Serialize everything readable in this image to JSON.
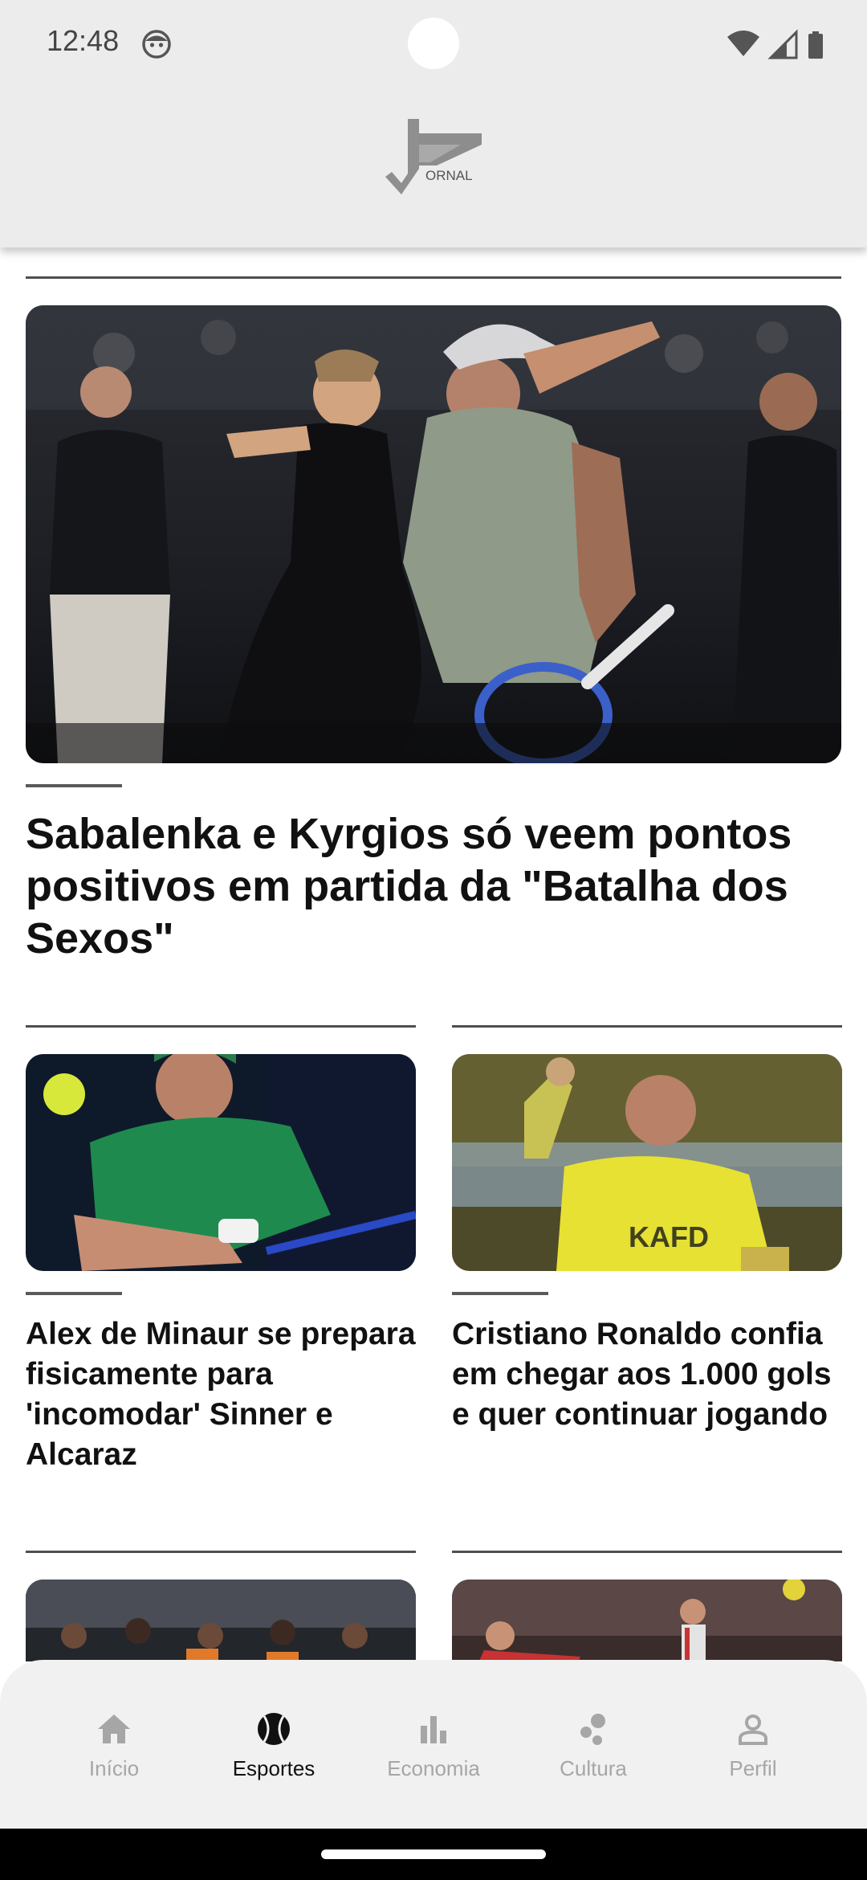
{
  "status_bar": {
    "time": "12:48"
  },
  "app": {
    "logo_text": "ORNAL"
  },
  "featured_article": {
    "title": "Sabalenka e Kyrgios só veem pontos positivos em partida da \"Batalha dos Sexos\""
  },
  "articles": [
    {
      "title": "Alex de Minaur se prepara fisicamente para 'incomodar' Sinner e Alcaraz"
    },
    {
      "title": "Cristiano Ronaldo confia em chegar aos 1.000 gols e quer continuar jogando"
    }
  ],
  "bottom_nav": {
    "items": [
      {
        "label": "Início",
        "icon": "home-icon",
        "active": false
      },
      {
        "label": "Esportes",
        "icon": "sports-ball-icon",
        "active": true
      },
      {
        "label": "Economia",
        "icon": "bar-chart-icon",
        "active": false
      },
      {
        "label": "Cultura",
        "icon": "culture-icon",
        "active": false
      },
      {
        "label": "Perfil",
        "icon": "person-icon",
        "active": false
      }
    ]
  },
  "colors": {
    "app_bar": "#ececec",
    "nav_background": "#f1f1f1",
    "nav_active": "#111111",
    "nav_inactive": "#a6a6a6"
  }
}
